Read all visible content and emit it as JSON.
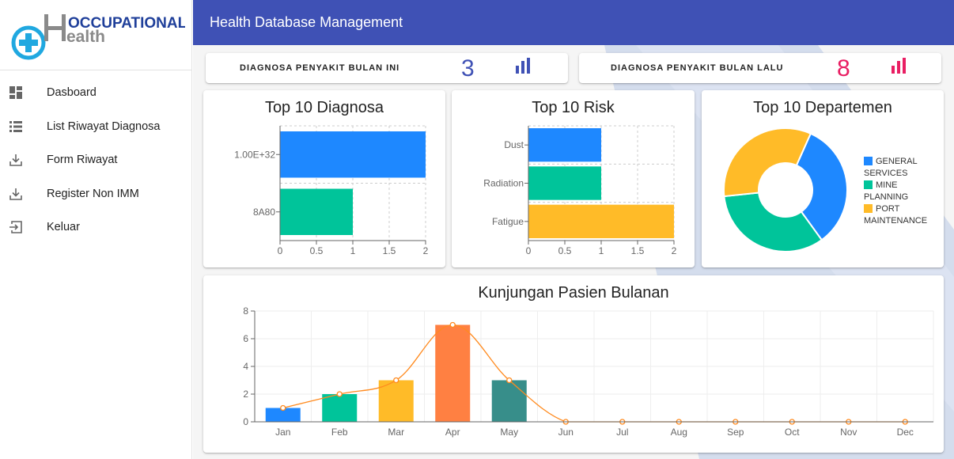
{
  "logo": {
    "line1": "OCCUPATIONAL",
    "line2": "ealth"
  },
  "sidebar": {
    "items": [
      {
        "label": "Dasboard",
        "icon": "dashboard-icon"
      },
      {
        "label": "List Riwayat Diagnosa",
        "icon": "list-icon"
      },
      {
        "label": "Form Riwayat",
        "icon": "download-icon"
      },
      {
        "label": "Register Non IMM",
        "icon": "download-icon"
      },
      {
        "label": "Keluar",
        "icon": "logout-icon"
      }
    ]
  },
  "header": {
    "title": "Health Database Management"
  },
  "stats": [
    {
      "label": "DIAGNOSA PENYAKIT BULAN INI",
      "value": "3",
      "color": "#3f51b5",
      "icon": "bar-chart-icon"
    },
    {
      "label": "DIAGNOSA PENYAKIT BULAN LALU",
      "value": "8",
      "color": "#e91e63",
      "icon": "bar-chart-icon"
    }
  ],
  "chart_data": [
    {
      "type": "bar",
      "orientation": "horizontal",
      "title": "Top 10 Diagnosa",
      "categories": [
        "1.00E+32",
        "8A80"
      ],
      "values": [
        2,
        1
      ],
      "colors": [
        "#1e88ff",
        "#00c49a"
      ],
      "xlim": [
        0,
        2
      ],
      "xticks": [
        "0",
        "0.5",
        "1",
        "1.5",
        "2"
      ],
      "grid": true
    },
    {
      "type": "bar",
      "orientation": "horizontal",
      "title": "Top 10 Risk",
      "categories": [
        "Dust",
        "Radiation",
        "Fatigue"
      ],
      "values": [
        1,
        1,
        2
      ],
      "colors": [
        "#1e88ff",
        "#00c49a",
        "#ffbb28"
      ],
      "xlim": [
        0,
        2
      ],
      "xticks": [
        "0",
        "0.5",
        "1",
        "1.5",
        "2"
      ],
      "grid": true
    },
    {
      "type": "pie",
      "donut": true,
      "title": "Top 10 Departemen",
      "categories": [
        "GENERAL SERVICES",
        "MINE PLANNING",
        "PORT MAINTENANCE"
      ],
      "values": [
        1,
        1,
        1
      ],
      "colors": [
        "#1e88ff",
        "#00c49a",
        "#ffbb28"
      ],
      "legend_position": "right"
    },
    {
      "type": "bar",
      "title": "Kunjungan Pasien Bulanan",
      "categories": [
        "Jan",
        "Feb",
        "Mar",
        "Apr",
        "May",
        "Jun",
        "Jul",
        "Aug",
        "Sep",
        "Oct",
        "Nov",
        "Dec"
      ],
      "values": [
        1,
        2,
        3,
        7,
        3,
        0,
        0,
        0,
        0,
        0,
        0,
        0
      ],
      "line_values": [
        1,
        2,
        3,
        7,
        3,
        0,
        0,
        0,
        0,
        0,
        0,
        0
      ],
      "colors": [
        "#1e88ff",
        "#00c49a",
        "#ffbb28",
        "#ff8042",
        "#378e8a",
        "#1e88ff",
        "#1e88ff",
        "#1e88ff",
        "#1e88ff",
        "#1e88ff",
        "#1e88ff",
        "#1e88ff"
      ],
      "line_color": "#ff8a1e",
      "ylim": [
        0,
        8
      ],
      "yticks": [
        "0",
        "2",
        "4",
        "6",
        "8"
      ],
      "grid": true
    }
  ]
}
